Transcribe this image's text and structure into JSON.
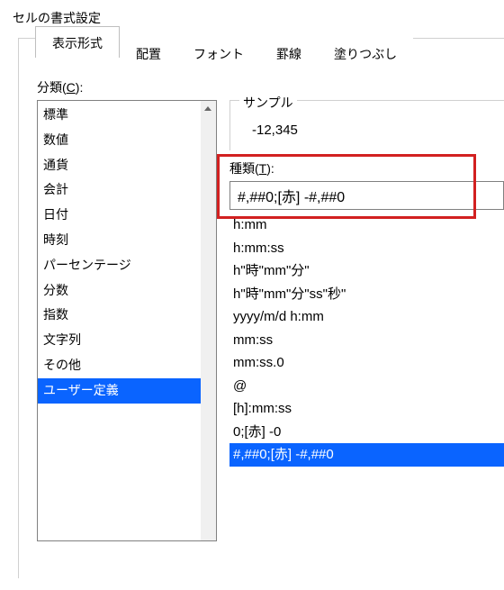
{
  "window_title": "セルの書式設定",
  "tabs": [
    {
      "label": "表示形式",
      "active": true
    },
    {
      "label": "配置"
    },
    {
      "label": "フォント"
    },
    {
      "label": "罫線"
    },
    {
      "label": "塗りつぶし"
    }
  ],
  "category_label_prefix": "分類(",
  "category_label_u": "C",
  "category_label_suffix": "):",
  "categories": [
    "標準",
    "数値",
    "通貨",
    "会計",
    "日付",
    "時刻",
    "パーセンテージ",
    "分数",
    "指数",
    "文字列",
    "その他",
    "ユーザー定義"
  ],
  "category_selected_index": 11,
  "sample_label": "サンプル",
  "sample_value": "-12,345",
  "type_label_prefix": "種類(",
  "type_label_u": "T",
  "type_label_suffix": "):",
  "type_input_value": "#,##0;[赤] -#,##0",
  "type_items": [
    "h:mm",
    "h:mm:ss",
    "h\"時\"mm\"分\"",
    "h\"時\"mm\"分\"ss\"秒\"",
    "yyyy/m/d h:mm",
    "mm:ss",
    "mm:ss.0",
    "@",
    "[h]:mm:ss",
    "0;[赤] -0",
    "#,##0;[赤] -#,##0"
  ],
  "type_selected_index": 10
}
